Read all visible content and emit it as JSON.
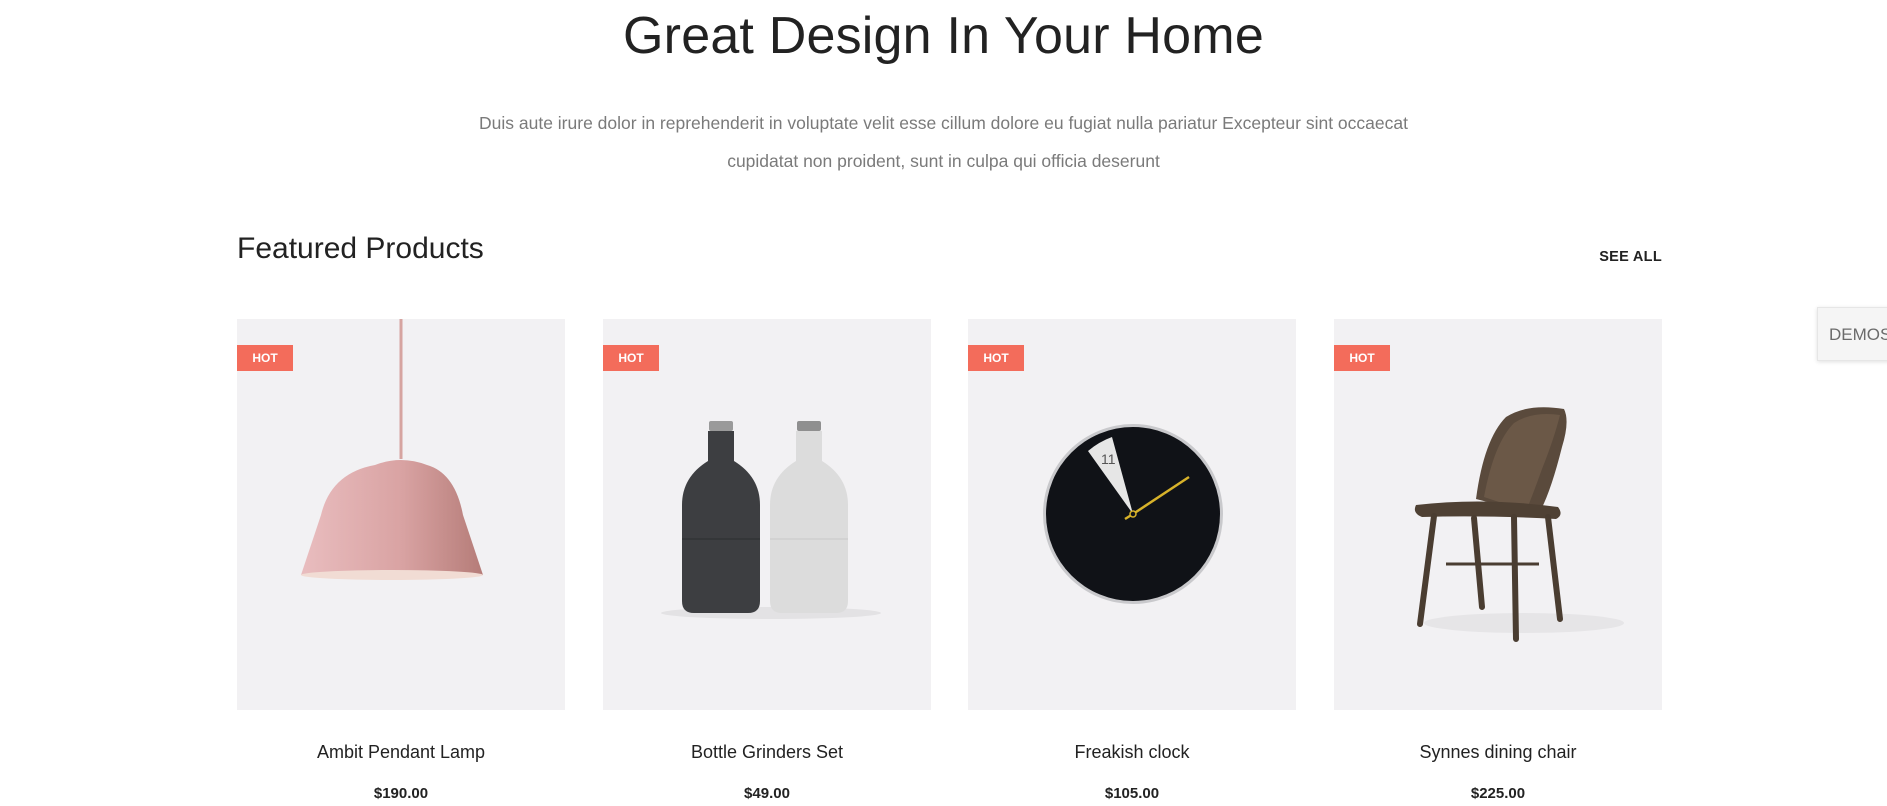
{
  "hero": {
    "title": "Great Design In Your Home",
    "description": "Duis aute irure dolor in reprehenderit in voluptate velit esse cillum dolore eu fugiat nulla pariatur Excepteur sint occaecat cupidatat non proident, sunt in culpa qui officia deserunt"
  },
  "featured": {
    "title": "Featured Products",
    "see_all": "SEE ALL",
    "products": [
      {
        "badge": "HOT",
        "name": "Ambit Pendant Lamp",
        "price": "$190.00"
      },
      {
        "badge": "HOT",
        "name": "Bottle Grinders Set",
        "price": "$49.00"
      },
      {
        "badge": "HOT",
        "name": "Freakish clock",
        "price": "$105.00"
      },
      {
        "badge": "HOT",
        "name": "Synnes dining chair",
        "price": "$225.00"
      }
    ]
  },
  "clock_number": "11",
  "demos_tab": "DEMOS",
  "colors": {
    "badge": "#f36c5b",
    "card_bg": "#f2f1f3"
  }
}
